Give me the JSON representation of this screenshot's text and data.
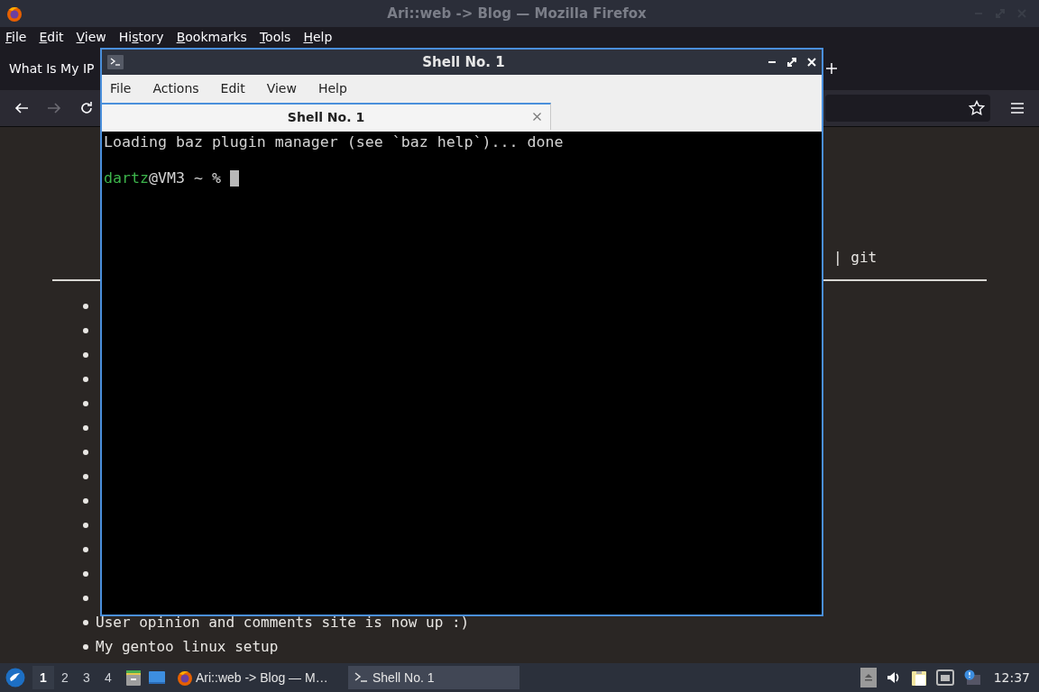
{
  "browser": {
    "title": "Ari::web -> Blog — Mozilla Firefox",
    "menu": [
      {
        "key": "F",
        "post": "ile"
      },
      {
        "key": "E",
        "post": "dit"
      },
      {
        "key": "V",
        "post": "iew"
      },
      {
        "pre": "Hi",
        "key": "s",
        "post": "tory"
      },
      {
        "key": "B",
        "post": "ookmarks"
      },
      {
        "key": "T",
        "post": "ools"
      },
      {
        "key": "H",
        "post": "elp"
      }
    ],
    "tabs": [
      {
        "label": "What Is My IP",
        "selected": false
      }
    ],
    "nav_buttons": [
      {
        "kind": "back",
        "disabled": false
      },
      {
        "kind": "forward",
        "disabled": true
      },
      {
        "kind": "reload",
        "disabled": false
      }
    ],
    "page": {
      "nav_tail": "| git",
      "list": [
        {
          "kind": "covered"
        },
        {
          "kind": "covered"
        },
        {
          "kind": "covered"
        },
        {
          "kind": "covered"
        },
        {
          "kind": "covered"
        },
        {
          "kind": "covered"
        },
        {
          "kind": "covered"
        },
        {
          "kind": "covered"
        },
        {
          "kind": "covered"
        },
        {
          "kind": "covered"
        },
        {
          "kind": "covered"
        },
        {
          "kind": "covered"
        },
        {
          "kind": "covered"
        },
        {
          "kind": "text",
          "text": "User opinion and comments site is now up :)"
        },
        {
          "kind": "text",
          "text": "My gentoo linux setup"
        }
      ]
    }
  },
  "terminal": {
    "title": "Shell No. 1",
    "menu": [
      "File",
      "Actions",
      "Edit",
      "View",
      "Help"
    ],
    "tabs": [
      {
        "label": "Shell No. 1",
        "selected": true
      }
    ],
    "lines": [
      {
        "kind": "output",
        "text": "Loading baz plugin manager (see `baz help`)... done"
      },
      {
        "kind": "blank"
      },
      {
        "kind": "prompt",
        "user": "dartz",
        "rest": "@VM3 ~ %"
      }
    ]
  },
  "taskbar": {
    "workspaces": [
      {
        "label": "1",
        "selected": true
      },
      {
        "label": "2",
        "selected": false
      },
      {
        "label": "3",
        "selected": false
      },
      {
        "label": "4",
        "selected": false
      }
    ],
    "tasks": [
      {
        "kind": "browser",
        "label": "Ari::web -> Blog — M…",
        "selected": false
      },
      {
        "kind": "terminal",
        "label": "Shell No. 1",
        "selected": true
      }
    ],
    "clock": "12:37"
  }
}
